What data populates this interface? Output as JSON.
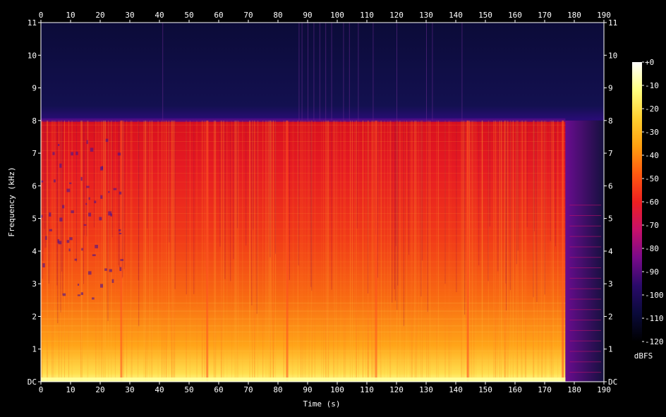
{
  "chart_data": {
    "type": "heatmap",
    "title": "",
    "xlabel": "Time (s)",
    "ylabel": "Frequency (kHz)",
    "xlim": [
      0,
      190
    ],
    "ylim": [
      0,
      11
    ],
    "x_ticks": [
      "0",
      "10",
      "20",
      "30",
      "40",
      "50",
      "60",
      "70",
      "80",
      "90",
      "100",
      "110",
      "120",
      "130",
      "140",
      "150",
      "160",
      "170",
      "180",
      "190"
    ],
    "x_tick_values": [
      0,
      10,
      20,
      30,
      40,
      50,
      60,
      70,
      80,
      90,
      100,
      110,
      120,
      130,
      140,
      150,
      160,
      170,
      180,
      190
    ],
    "y_ticks": [
      "DC",
      "1",
      "2",
      "3",
      "4",
      "5",
      "6",
      "7",
      "8",
      "9",
      "10",
      "11"
    ],
    "y_tick_values": [
      0,
      1,
      2,
      3,
      4,
      5,
      6,
      7,
      8,
      9,
      10,
      11
    ],
    "colorbar": {
      "label": "dBFS",
      "ticks": [
        "+0",
        "-10",
        "-20",
        "-30",
        "-40",
        "-50",
        "-60",
        "-70",
        "-80",
        "-90",
        "-100",
        "-110",
        "-120"
      ],
      "tick_values": [
        0,
        -10,
        -20,
        -30,
        -40,
        -50,
        -60,
        -70,
        -80,
        -90,
        -100,
        -110,
        -120
      ],
      "range": [
        -120,
        0
      ],
      "colors": [
        "#000000",
        "#0a0a3a",
        "#2a0a6a",
        "#7a0a8a",
        "#c8106a",
        "#ee2020",
        "#ff5a10",
        "#ffa010",
        "#ffd030",
        "#ffff80",
        "#ffffff"
      ]
    },
    "spectrum": {
      "cutoff_khz": 8,
      "audio_end_s": 177,
      "section_breaks_s": [
        27,
        56,
        83,
        113,
        144,
        176
      ],
      "band_levels_db": [
        {
          "from_khz": 0,
          "to_khz": 0.5,
          "level": -18
        },
        {
          "from_khz": 0.5,
          "to_khz": 2,
          "level": -30
        },
        {
          "from_khz": 2,
          "to_khz": 4,
          "level": -42
        },
        {
          "from_khz": 4,
          "to_khz": 8,
          "level": -52
        },
        {
          "from_khz": 8,
          "to_khz": 11,
          "level": -112
        }
      ]
    }
  }
}
